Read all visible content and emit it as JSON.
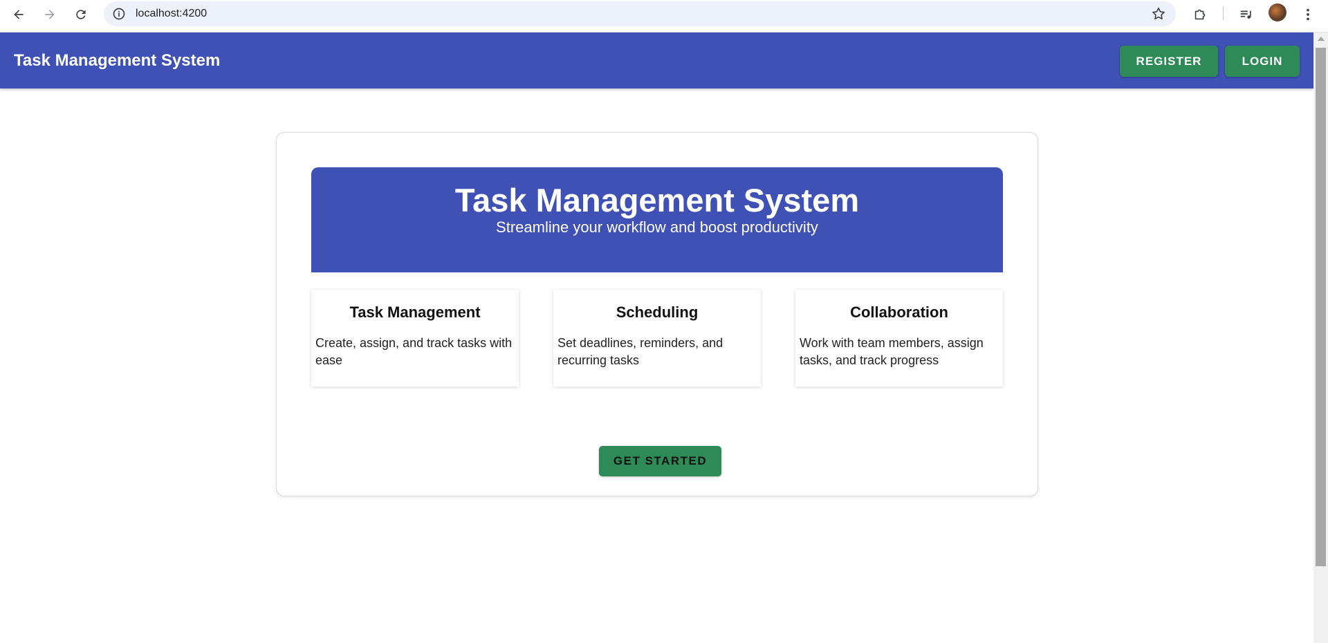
{
  "browser": {
    "url": "localhost:4200",
    "icons": {
      "back": "arrow-left-icon",
      "forward": "arrow-right-icon",
      "reload": "reload-icon",
      "site_info": "info-icon",
      "bookmark": "star-icon",
      "extensions": "puzzle-icon",
      "media": "media-queue-icon",
      "menu": "kebab-menu-icon"
    }
  },
  "header": {
    "brand": "Task Management System",
    "register_label": "REGISTER",
    "login_label": "LOGIN"
  },
  "hero": {
    "title": "Task Management System",
    "subtitle": "Streamline your workflow and boost productivity"
  },
  "features": [
    {
      "title": "Task Management",
      "description": "Create, assign, and track tasks with ease"
    },
    {
      "title": "Scheduling",
      "description": "Set deadlines, reminders, and recurring tasks"
    },
    {
      "title": "Collaboration",
      "description": "Work with team members, assign tasks, and track progress"
    }
  ],
  "cta": {
    "label": "GET STARTED"
  },
  "colors": {
    "primary": "#3f51b5",
    "accent": "#2e8b57"
  }
}
